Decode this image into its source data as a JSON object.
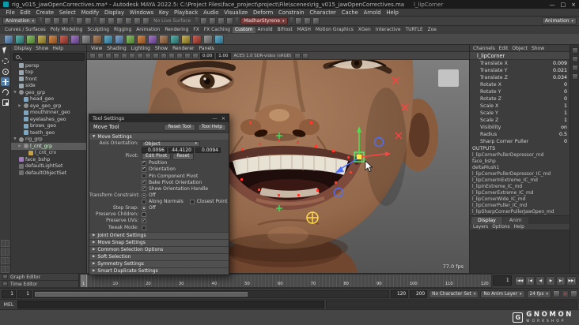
{
  "colors": {
    "accent_blue": "#4f7ba7",
    "selection_green": "#49ff70",
    "axis_red": "#ff4444",
    "axis_green": "#49e049",
    "axis_blue": "#4b6fff",
    "control_yellow": "#ffd94a",
    "skin": "#94684a"
  },
  "titlebar": {
    "title": "rig_v015_jawOpenCorrectives.ma* - Autodesk MAYA 2022.5: C:\\Project Files\\face_project\\project\\File\\scenes\\rig_v015_jawOpenCorrectives.ma",
    "selection": "l_lipCorner",
    "minimize": "—",
    "maximize": "□",
    "close": "×"
  },
  "menubar": {
    "items": [
      "File",
      "Edit",
      "Create",
      "Select",
      "Modify",
      "Display",
      "Windows",
      "Key",
      "Playback",
      "Audio",
      "Visualize",
      "Deform",
      "Constrain",
      "Character",
      "Cache",
      "Arnold",
      "Help"
    ]
  },
  "statusline": {
    "menuset": "Animation",
    "no_live_surface": "No Live Surface",
    "selection_field": "MadharStyrene",
    "workspace_value": "Animation"
  },
  "shelf": {
    "tabs": [
      "Curves / Surfaces",
      "Poly Modeling",
      "Sculpting",
      "Rigging",
      "Animation",
      "Rendering",
      "FX",
      "FX Caching",
      "Custom",
      "Arnold",
      "Bifrost",
      "MASH",
      "Motion Graphics",
      "XGen",
      "Interactive",
      "TURTLE",
      "Zoe"
    ]
  },
  "outliner": {
    "menus": [
      "Display",
      "Show",
      "Help"
    ],
    "items": [
      {
        "name": "persp"
      },
      {
        "name": "top"
      },
      {
        "name": "front"
      },
      {
        "name": "side"
      },
      {
        "name": "geo_grp"
      },
      {
        "name": "head_geo"
      },
      {
        "name": "eye_geo_grp"
      },
      {
        "name": "mouthInner_geo"
      },
      {
        "name": "eyelashes_geo"
      },
      {
        "name": "brows_geo"
      },
      {
        "name": "teeth_geo"
      },
      {
        "name": "rig_grp"
      },
      {
        "name": "l_cnt_grp"
      },
      {
        "name": "l_cnt_crv"
      },
      {
        "name": "face_bshp"
      },
      {
        "name": "defaultLightSet"
      },
      {
        "name": "defaultObjectSet"
      }
    ]
  },
  "viewport": {
    "menus": [
      "View",
      "Shading",
      "Lighting",
      "Show",
      "Renderer",
      "Panels"
    ],
    "exposure": "0.00",
    "gamma": "1.00",
    "color_space": "ACES 1.0 SDR-video (sRGB)",
    "fps_hud": "77.0 fps"
  },
  "tool_settings": {
    "window_title": "Tool Settings",
    "tool_name": "Move Tool",
    "reset_label": "Reset Tool",
    "help_label": "Tool Help",
    "section": "Move Settings",
    "axis_orientation_label": "Axis Orientation:",
    "axis_orientation_value": "Object",
    "fields": [
      "0.0096",
      "44.4120",
      "0.0094"
    ],
    "pivot_label": "Pivot:",
    "edit_pivot_label": "Edit Pivot",
    "reset_pivot_label": "Reset",
    "checkboxes": [
      {
        "label": "Position",
        "mark": "✓"
      },
      {
        "label": "Orientation",
        "mark": "✓"
      },
      {
        "label": "Pin Component Pivot",
        "mark": ""
      },
      {
        "label": "Bake Pivot Orientation",
        "mark": "✓"
      },
      {
        "label": "Show Orientation Handle",
        "mark": "✓"
      }
    ],
    "transform_constraint_label": "Transform Constraint:",
    "transform_constraint_value": "Off",
    "along_normals": {
      "label": "Along Normals",
      "mark": ""
    },
    "closest_point": {
      "label": "Closest Point",
      "mark": ""
    },
    "step_snap_label": "Step Snap:",
    "step_snap_value": "Off",
    "preserve_children_label": "Preserve Children:",
    "preserve_children_mark": "",
    "preserve_uvs_label": "Preserve UVs:",
    "preserve_uvs_mark": "✓",
    "tweak_mode_label": "Tweak Mode:",
    "tweak_mode_mark": "",
    "collapsed_sections": [
      "Joint Orient Settings",
      "Move Snap Settings",
      "Common Selection Options",
      "Soft Selection",
      "Symmetry Settings",
      "Smart Duplicate Settings"
    ]
  },
  "channelbox": {
    "menus": [
      "Channels",
      "Edit",
      "Object",
      "Show"
    ],
    "object": "l_lipCorner",
    "attrs": [
      {
        "name": "Translate X",
        "value": "0.009"
      },
      {
        "name": "Translate Y",
        "value": "0.021"
      },
      {
        "name": "Translate Z",
        "value": "0.034"
      },
      {
        "name": "Rotate X",
        "value": "0"
      },
      {
        "name": "Rotate Y",
        "value": "0"
      },
      {
        "name": "Rotate Z",
        "value": "0"
      },
      {
        "name": "Scale X",
        "value": "1"
      },
      {
        "name": "Scale Y",
        "value": "1"
      },
      {
        "name": "Scale Z",
        "value": "1"
      },
      {
        "name": "Visibility",
        "value": "on"
      },
      {
        "name": "Radius",
        "value": "0.5"
      },
      {
        "name": "Sharp Corner Puller",
        "value": "0"
      }
    ],
    "outputs_label": "OUTPUTS",
    "outputs": [
      "l_lipCornerPullerDepressor_md",
      "face_bshp",
      "deltaMush1",
      "l_lipCornerPullerDepressor_IC_md",
      "l_lipCornerInExtreme_IC_md",
      "l_lipInExtreme_IC_md",
      "l_lipCornerExtreme_IC_md",
      "l_lipCornerWide_IC_md",
      "l_lipCornerPuller_IC_md",
      "l_lipSharpCornerPullerJawOpen_md"
    ]
  },
  "layers": {
    "tabs": [
      "Display",
      "Anim"
    ],
    "menus": [
      "Layers",
      "Options",
      "Help"
    ]
  },
  "bottom": {
    "editor_tabs": [
      "Graph Editor",
      "Time Editor"
    ]
  },
  "timeline": {
    "labels": [
      "1",
      "10",
      "20",
      "30",
      "40",
      "50",
      "60",
      "70",
      "80",
      "90",
      "100",
      "110",
      "120"
    ],
    "current": "1",
    "transport": [
      "|◀◀",
      "|◀",
      "◀",
      "▶",
      "▶|",
      "▶▶|"
    ]
  },
  "range": {
    "anim_start": "1",
    "play_start": "1",
    "play_end": "120",
    "anim_end": "200",
    "character_set": "No Character Set",
    "anim_layer": "No Anim Layer",
    "fps": "24 fps"
  },
  "command": {
    "label": "MEL"
  },
  "watermark": {
    "initial": "G",
    "line1": "GNOMON",
    "line2": "WORKSHOP"
  }
}
